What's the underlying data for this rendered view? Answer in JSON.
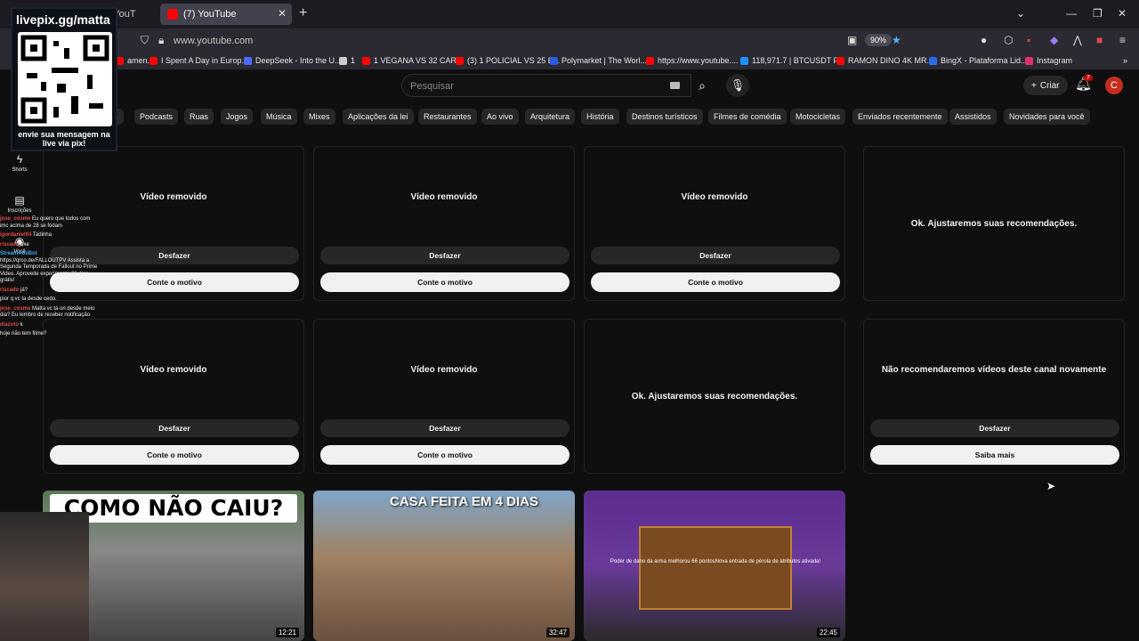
{
  "browser": {
    "tabs": [
      {
        "label": "ar - YouT"
      },
      {
        "label": "(7) YouTube"
      }
    ],
    "url": "www.youtube.com",
    "zoom": "90%",
    "bookmarks": [
      {
        "label": "amen...",
        "color": "#ff0000"
      },
      {
        "label": "I Spent A Day in Europ...",
        "color": "#ff0000"
      },
      {
        "label": "DeepSeek - Into the U...",
        "color": "#4d6bfe"
      },
      {
        "label": "1",
        "color": "#cccccc"
      },
      {
        "label": "1 VEGANA VS 32 CAR...",
        "color": "#ff0000"
      },
      {
        "label": "(3) 1 POLICIAL VS 25 E...",
        "color": "#ff0000"
      },
      {
        "label": "Polymarket | The Worl...",
        "color": "#2c5ce5"
      },
      {
        "label": "https://www.youtube....",
        "color": "#ff0000"
      },
      {
        "label": "118,971.7 | BTCUSDT P...",
        "color": "#1e90ff"
      },
      {
        "label": "RAMON DINO 4K MR...",
        "color": "#ff0000"
      },
      {
        "label": "BingX - Plataforma Lid...",
        "color": "#2a6cf0"
      },
      {
        "label": "Instagram",
        "color": "#e1306c"
      }
    ]
  },
  "youtube": {
    "search_placeholder": "Pesquisar",
    "create_label": "Criar",
    "notifications_count": "7",
    "avatar_letter": "C",
    "chips": [
      "s",
      "Podcasts",
      "Ruas",
      "Jogos",
      "Música",
      "Mixes",
      "Aplicações da lei",
      "Restaurantes",
      "Ao vivo",
      "Arquitetura",
      "História",
      "Destinos turísticos",
      "Filmes de comédia",
      "Motocicletas",
      "Enviados recentemente",
      "Assistidos",
      "Novidades para você"
    ],
    "sidebar": [
      {
        "label": "Shorts"
      },
      {
        "label": "Inscrições"
      },
      {
        "label": "Você"
      }
    ],
    "cards": [
      {
        "title": "Vídeo removido",
        "undo": "Desfazer",
        "action": "Conte o motivo"
      },
      {
        "title": "Vídeo removido",
        "undo": "Desfazer",
        "action": "Conte o motivo"
      },
      {
        "title": "Vídeo removido",
        "undo": "Desfazer",
        "action": "Conte o motivo"
      },
      {
        "title": "Ok. Ajustaremos suas recomendações."
      },
      {
        "title": "Vídeo removido",
        "undo": "Desfazer",
        "action": "Conte o motivo"
      },
      {
        "title": "Vídeo removido",
        "undo": "Desfazer",
        "action": "Conte o motivo"
      },
      {
        "title": "Ok. Ajustaremos suas recomendações."
      },
      {
        "title": "Não recomendaremos vídeos deste canal novamente",
        "undo": "Desfazer",
        "action": "Saiba mais"
      }
    ],
    "thumbnails": [
      {
        "text": "COMO NÃO CAIU?",
        "duration": "12:21"
      },
      {
        "text": "CASA FEITA EM 4 DIAS",
        "duration": "32:47"
      },
      {
        "text": "Poder de dano da arma melhorou 66 pontosNova entrada de pérola de atributos ativada!",
        "duration": "22:45"
      }
    ]
  },
  "stream_overlay": {
    "title": "livepix.gg/matta",
    "message": "envie sua mensagem na live via pix!",
    "chat": [
      {
        "user": "jose_cosme",
        "text": "Eu quero que todos com imc acima de 28 se fodam"
      },
      {
        "user": "igordaniel94",
        "text": "Tadinha"
      },
      {
        "user": "riscado",
        "text": "oxe"
      },
      {
        "user": "StreamAdsBot",
        "text": "https://qrco.de/FALLOUTPV Assista a Segunda Temporada de Fallout no Prime Video. Aproveite experimente 30 dias grátis!"
      },
      {
        "user": "riscado",
        "text": "já?"
      },
      {
        "user": "",
        "text": "pior q vc ta desde cedo."
      },
      {
        "user": "jose_cosme",
        "text": "Matta vc tá on desde meio dia? Eu lembro de receber notificação"
      },
      {
        "user": "diazoto",
        "text": "k"
      },
      {
        "user": "",
        "text": "hoje não tem filme?"
      }
    ]
  }
}
